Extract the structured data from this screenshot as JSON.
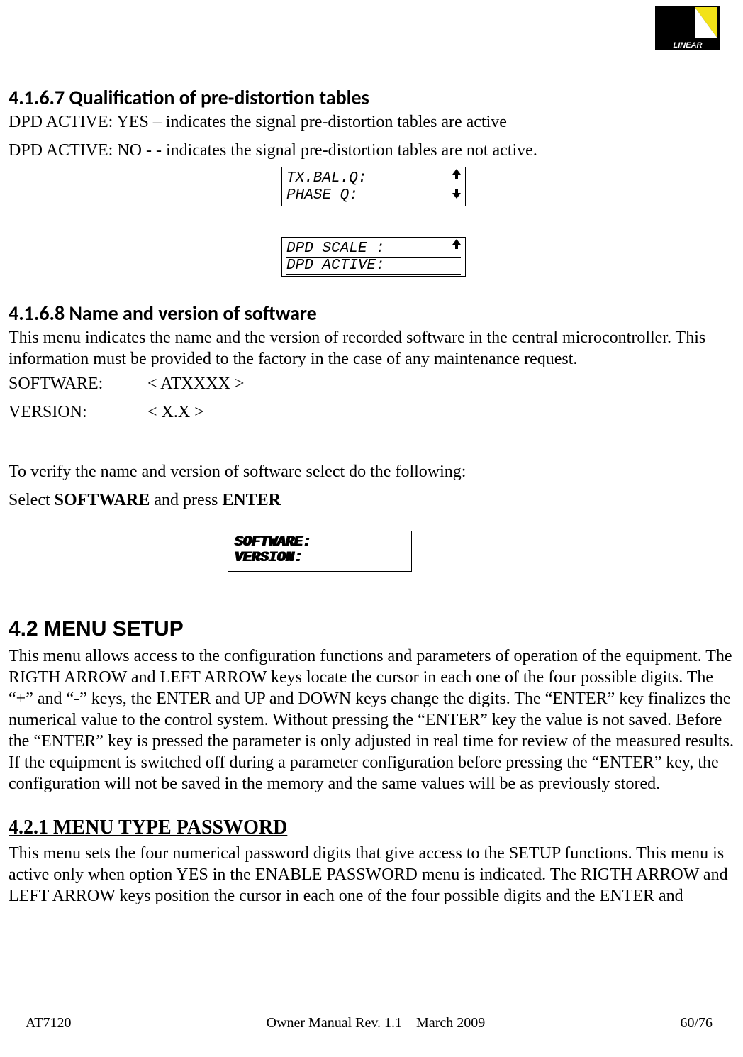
{
  "logo": {
    "brand": "LINEAR"
  },
  "sections": {
    "s4167": {
      "heading": "4.1.6.7 Qualification of pre-distortion tables",
      "p1": "DPD ACTIVE: YES – indicates the signal pre-distortion tables are active",
      "p2": "DPD ACTIVE: NO - - indicates the signal pre-distortion tables are not active."
    },
    "lcd1": {
      "line1": "TX.BAL.Q:",
      "line2": "PHASE  Q:"
    },
    "lcd2": {
      "line1": "DPD SCALE :",
      "line2": "DPD ACTIVE:"
    },
    "s4168": {
      "heading": "4.1.6.8 Name and version of software",
      "desc": "This menu indicates the name and the version of recorded software in the central microcontroller. This information must be provided to the factory in the case of any maintenance request.",
      "software_label": "SOFTWARE:",
      "software_value": "< ATXXXX >",
      "version_label": "VERSION:",
      "version_value": "< X.X >",
      "verify": "To verify the name and version of software select do the following:",
      "select_prefix": "Select ",
      "select_bold1": "SOFTWARE",
      "select_mid": " and press ",
      "select_bold2": "ENTER"
    },
    "lcd3": {
      "line1": "SOFTWARE:",
      "line2": "VERSION:"
    },
    "s42": {
      "heading": "4.2 MENU SETUP",
      "desc": "This menu allows access to the configuration functions and parameters of operation of the equipment. The RIGTH ARROW and LEFT ARROW keys locate the cursor in each one of the four possible digits. The “+” and “-” keys, the ENTER and UP and DOWN keys change the digits. The “ENTER” key finalizes the numerical value to the control system. Without pressing the “ENTER” key the value is not saved. Before the “ENTER” key is pressed the parameter is only adjusted in real time for review of the measured results. If the equipment is switched off during a parameter configuration before pressing the “ENTER” key, the configuration will not be saved in the memory and the same values will be as previously stored."
    },
    "s421": {
      "heading": "4.2.1 MENU TYPE PASSWORD",
      "desc": "This menu sets the four numerical password digits that give access to the SETUP functions. This menu is active only when option YES in the ENABLE PASSWORD menu is indicated. The RIGTH ARROW and LEFT ARROW keys position the cursor in each one of the four possible digits and the ENTER and"
    }
  },
  "footer": {
    "left": "AT7120",
    "center": "Owner Manual Rev. 1.1 – March 2009",
    "right": "60/76"
  }
}
